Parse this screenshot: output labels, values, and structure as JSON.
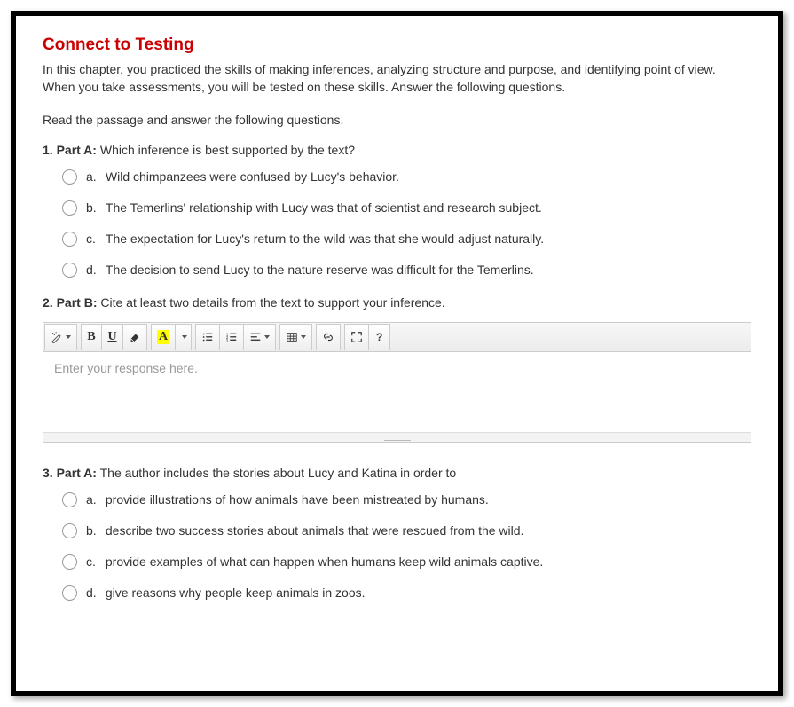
{
  "title": "Connect to Testing",
  "intro": "In this chapter, you practiced the skills of making inferences, analyzing structure and purpose, and identifying point of view. When you take assessments, you will be tested on these skills. Answer the following questions.",
  "directions": "Read the passage and answer the following questions.",
  "questions": [
    {
      "number": "1.",
      "part": "Part A:",
      "prompt": "Which inference is best supported by the text?",
      "options": [
        {
          "letter": "a.",
          "text": "Wild chimpanzees were confused by Lucy's behavior."
        },
        {
          "letter": "b.",
          "text": "The Temerlins' relationship with Lucy was that of scientist and research subject."
        },
        {
          "letter": "c.",
          "text": "The expectation for Lucy's return to the wild was that she would adjust naturally."
        },
        {
          "letter": "d.",
          "text": "The decision to send Lucy to the nature reserve was difficult for the Temerlins."
        }
      ]
    },
    {
      "number": "2.",
      "part": "Part B:",
      "prompt": "Cite at least two details from the text to support your inference.",
      "editor_placeholder": "Enter your response here."
    },
    {
      "number": "3.",
      "part": "Part A:",
      "prompt": "The author includes the stories about Lucy and Katina in order to",
      "options": [
        {
          "letter": "a.",
          "text": "provide illustrations of how animals have been mistreated by humans."
        },
        {
          "letter": "b.",
          "text": "describe two success stories about animals that were rescued from the wild."
        },
        {
          "letter": "c.",
          "text": "provide examples of what can happen when humans keep wild animals captive."
        },
        {
          "letter": "d.",
          "text": "give reasons why people keep animals in zoos."
        }
      ]
    }
  ],
  "toolbar": {
    "highlight_sample": "A"
  }
}
